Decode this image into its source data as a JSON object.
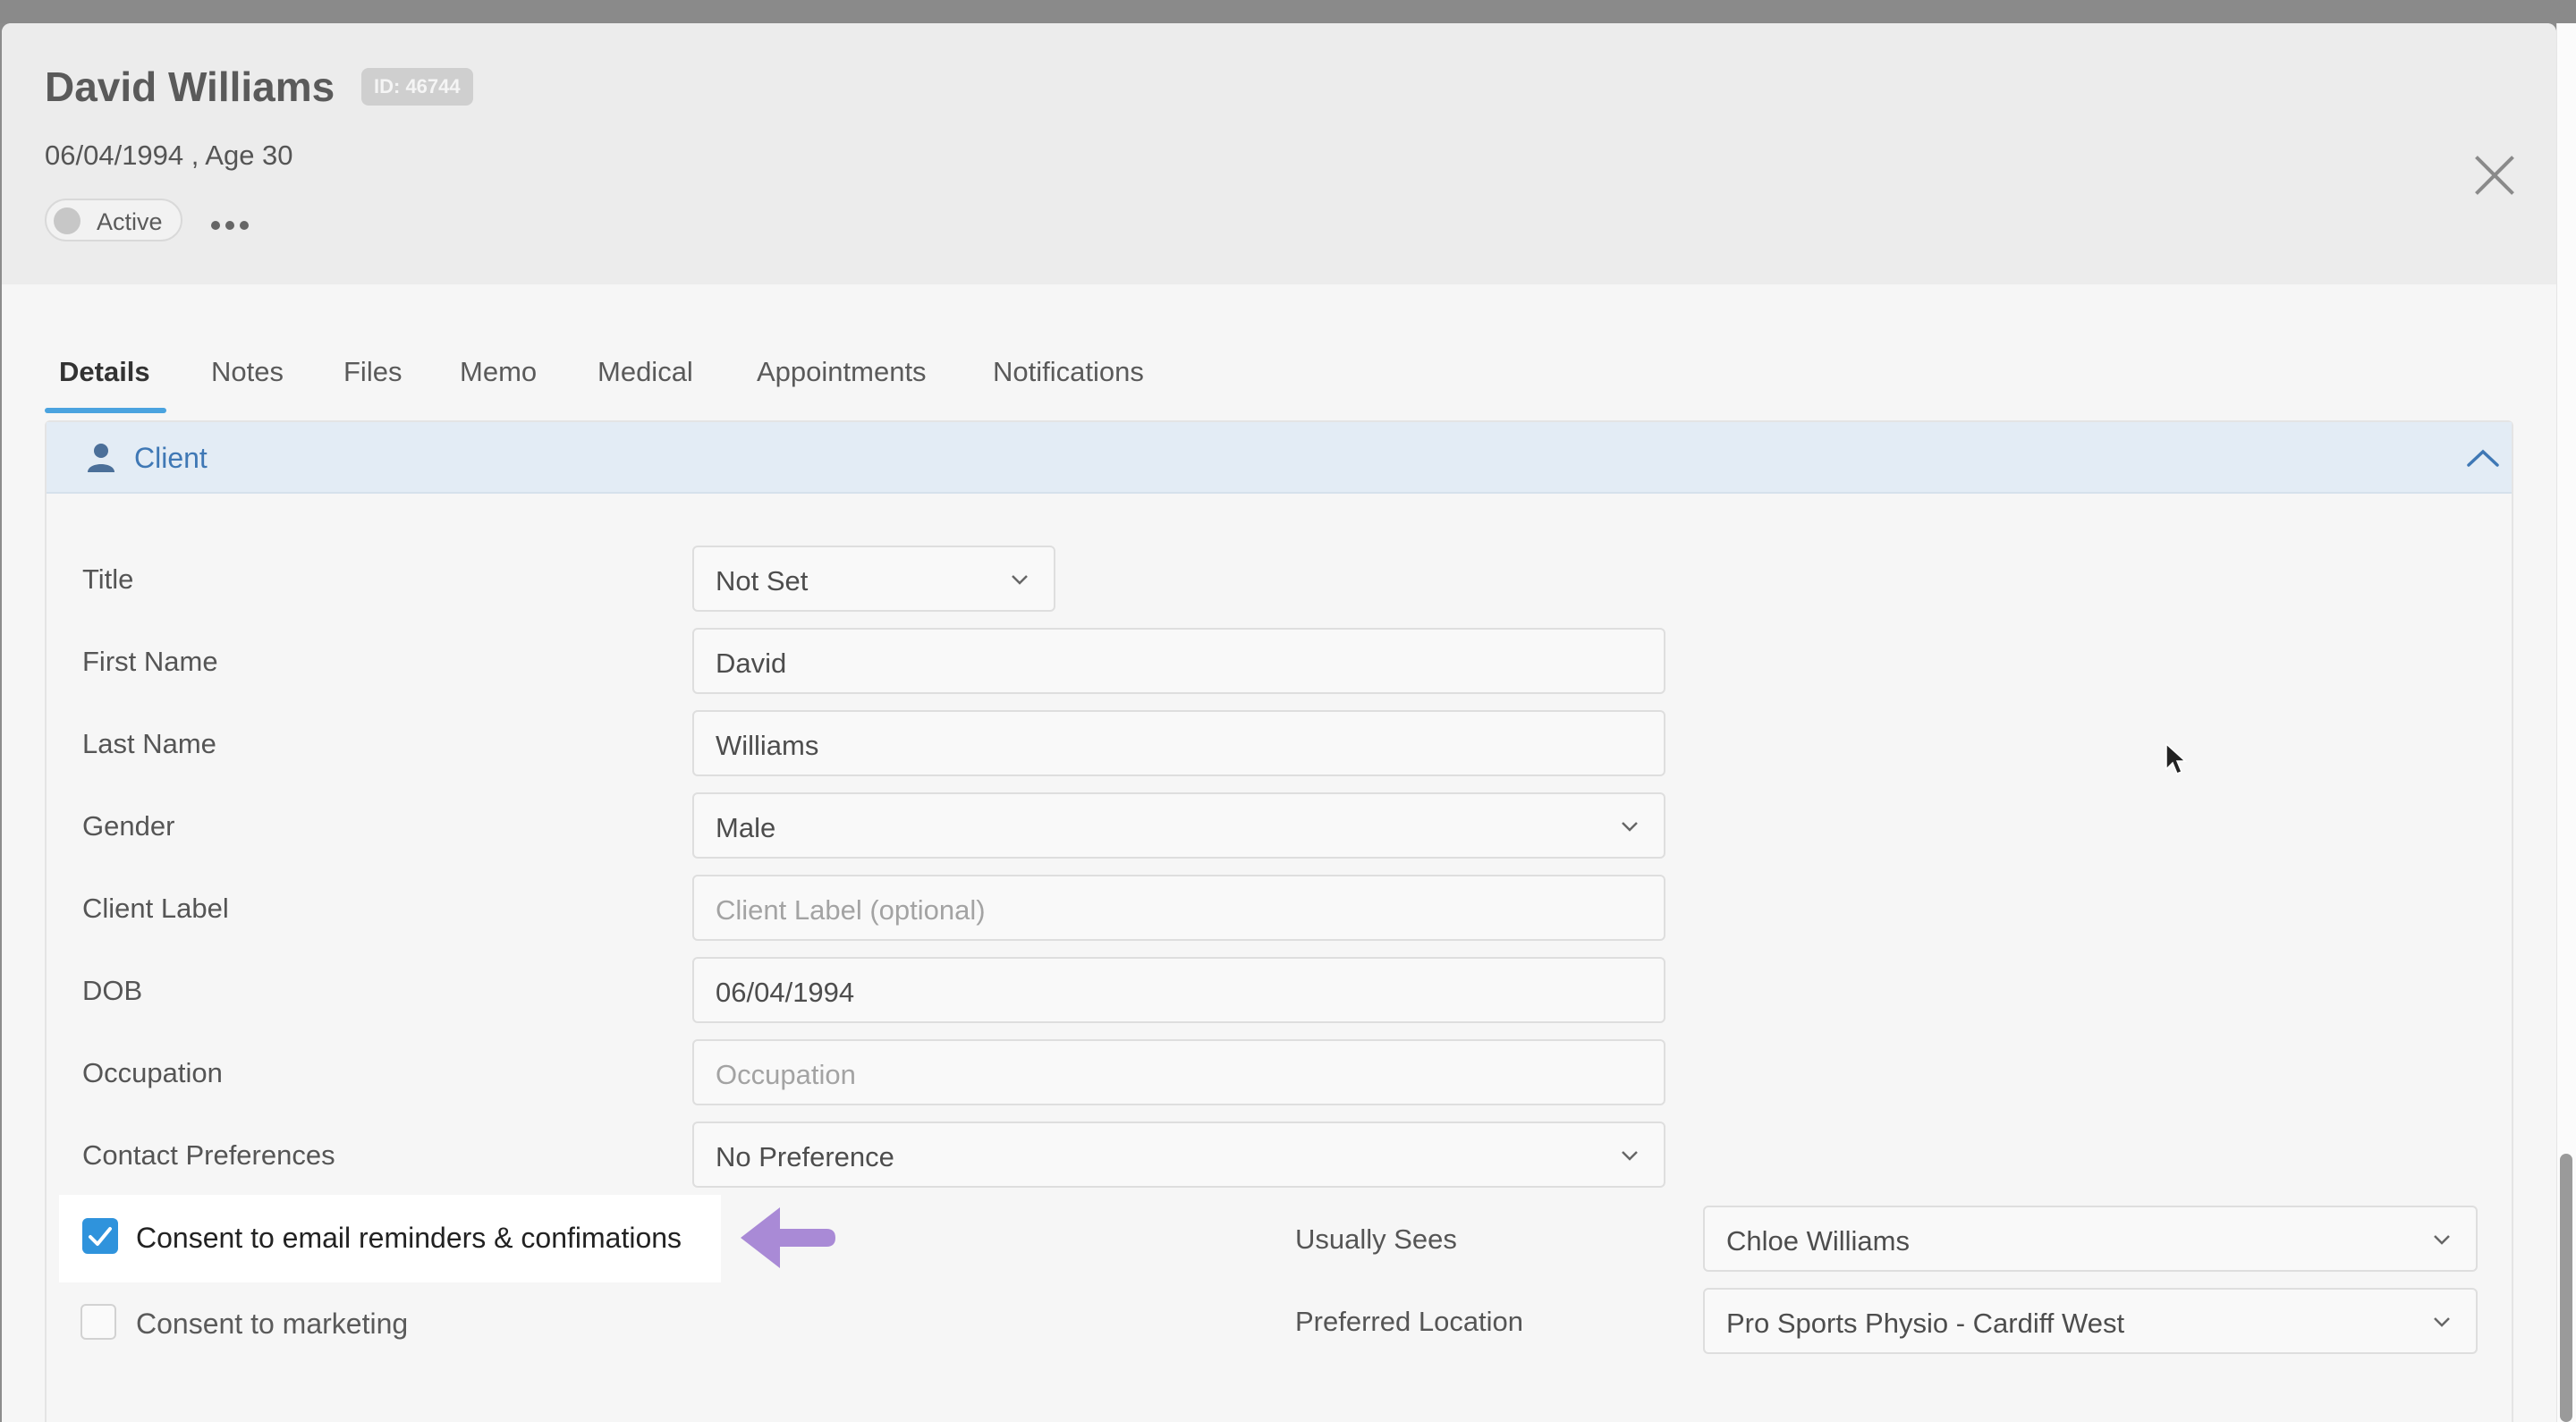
{
  "header": {
    "name": "David Williams",
    "id_badge": "ID: 46744",
    "dob_age": "06/04/1994 , Age 30",
    "status": "Active"
  },
  "tabs": [
    "Details",
    "Notes",
    "Files",
    "Memo",
    "Medical",
    "Appointments",
    "Notifications"
  ],
  "panel": {
    "title": "Client"
  },
  "form": {
    "title": {
      "label": "Title",
      "value": "Not Set"
    },
    "first_name": {
      "label": "First Name",
      "value": "David"
    },
    "last_name": {
      "label": "Last Name",
      "value": "Williams"
    },
    "gender": {
      "label": "Gender",
      "value": "Male"
    },
    "client_label": {
      "label": "Client Label",
      "placeholder": "Client Label (optional)"
    },
    "dob": {
      "label": "DOB",
      "value": "06/04/1994"
    },
    "occupation": {
      "label": "Occupation",
      "placeholder": "Occupation"
    },
    "contact_preferences": {
      "label": "Contact Preferences",
      "value": "No Preference"
    }
  },
  "consent": {
    "email_label": "Consent to email reminders & confimations",
    "email_checked": true,
    "marketing_label": "Consent to marketing",
    "marketing_checked": false
  },
  "right_fields": {
    "usually_sees": {
      "label": "Usually Sees",
      "value": "Chloe Williams"
    },
    "preferred_location": {
      "label": "Preferred Location",
      "value": "Pro Sports Physio - Cardiff West"
    }
  },
  "colors": {
    "accent": "#4aa3df",
    "checkbox": "#2f93dc",
    "panel_header": "#e3ecf5",
    "arrow": "#a98ad6"
  }
}
